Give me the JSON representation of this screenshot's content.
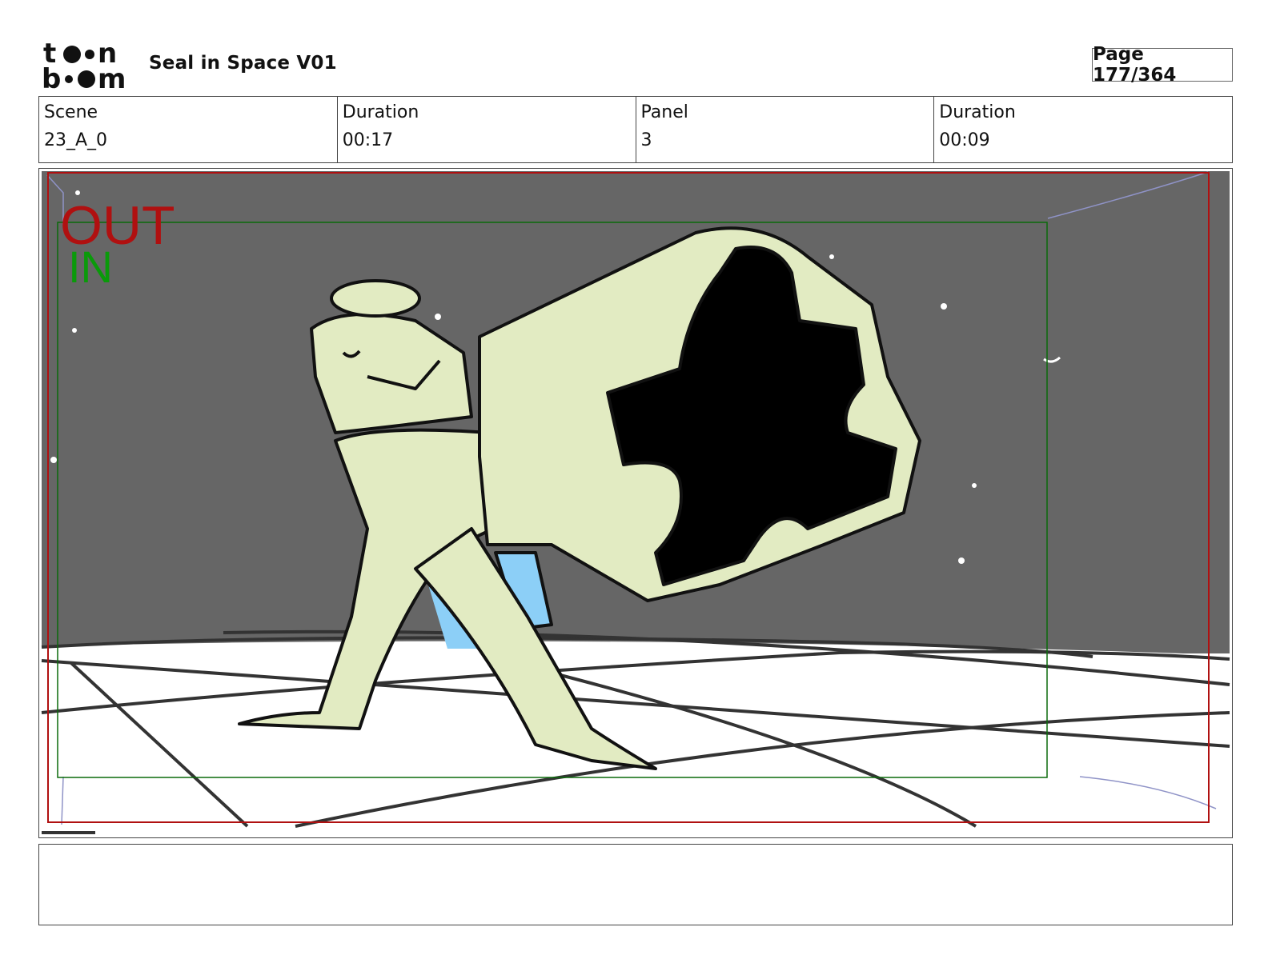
{
  "header": {
    "logo_text_top": "toon",
    "logo_text_bottom": "boom",
    "title": "Seal in Space V01",
    "page_label": "Page 177/364"
  },
  "info": {
    "scene_label": "Scene",
    "scene_value": "23_A_0",
    "scene_duration_label": "Duration",
    "scene_duration_value": "00:17",
    "panel_label": "Panel",
    "panel_value": "3",
    "panel_duration_label": "Duration",
    "panel_duration_value": "00:09"
  },
  "frame_markers": {
    "out_label": "OUT",
    "in_label": "IN",
    "out_color": "#b01010",
    "in_color": "#0a8a0a"
  },
  "notes": ""
}
